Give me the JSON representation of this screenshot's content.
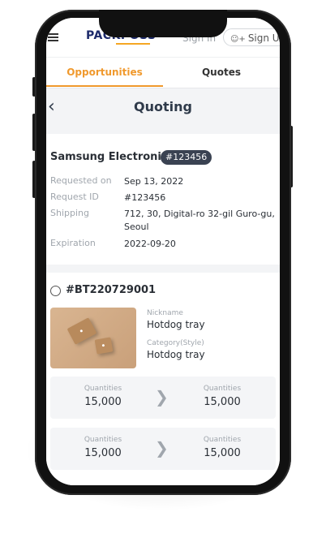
{
  "header": {
    "logo": "PACKPOSS",
    "sign_in": "Sign In",
    "sign_up": "Sign Up"
  },
  "tabs": [
    {
      "label": "Opportunities",
      "active": true
    },
    {
      "label": "Quotes",
      "active": false
    }
  ],
  "page": {
    "title": "Quoting"
  },
  "request": {
    "company": "Samsung Electronic",
    "badge": "#123456",
    "fields": [
      {
        "key": "Requested on",
        "value": "Sep 13, 2022"
      },
      {
        "key": "Request ID",
        "value": "#123456"
      },
      {
        "key": "Shipping",
        "value": "712, 30, Digital-ro 32-gil Guro-gu, Seoul"
      },
      {
        "key": "Expiration",
        "value": "2022-09-20"
      }
    ]
  },
  "quote": {
    "id": "#BT220729001",
    "nickname_label": "Nickname",
    "nickname": "Hotdog tray",
    "category_label": "Category(Style)",
    "category": "Hotdog tray",
    "quantities": [
      {
        "from_label": "Quantities",
        "from": "15,000",
        "to_label": "Quantities",
        "to": "15,000"
      },
      {
        "from_label": "Quantities",
        "from": "15,000",
        "to_label": "Quantities",
        "to": "15,000"
      }
    ]
  },
  "colors": {
    "accent": "#f0992d",
    "badge_bg": "#3a4252",
    "text": "#2a2f36",
    "muted": "#a0a6ad"
  }
}
